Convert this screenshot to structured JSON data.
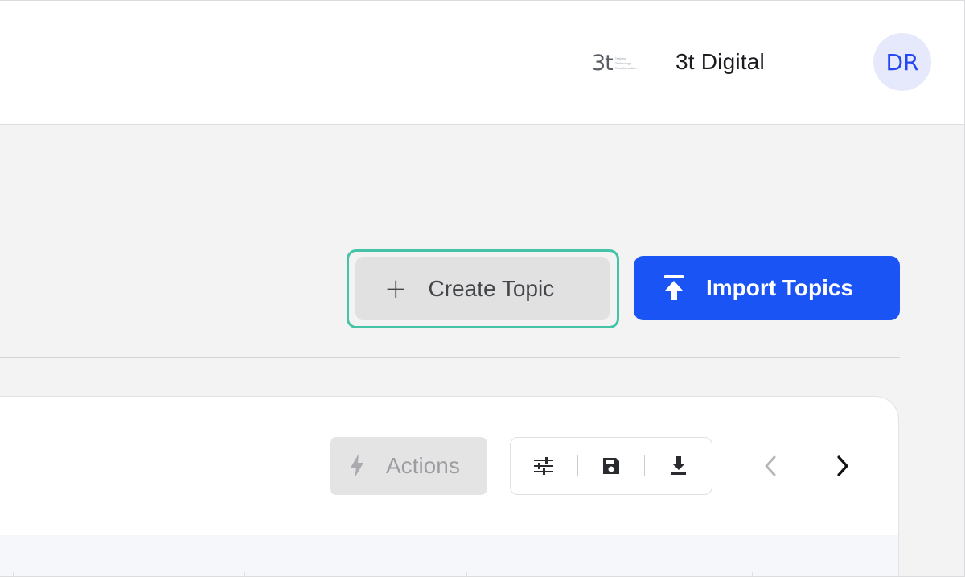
{
  "header": {
    "org_logo": {
      "mark": "3t",
      "tagline": [
        "Training",
        "Technology",
        "Transformation"
      ]
    },
    "org_name": "3t Digital",
    "avatar_initials": "DR"
  },
  "toolbar": {
    "create_label": "Create Topic",
    "create_icon": "plus-icon",
    "import_label": "Import Topics",
    "import_icon": "upload-icon"
  },
  "table_controls": {
    "actions_label": "Actions",
    "actions_icon": "lightning-icon",
    "actions_enabled": false,
    "tools": [
      "sliders-icon",
      "save-icon",
      "download-icon"
    ],
    "prev_enabled": false,
    "next_enabled": true
  },
  "colors": {
    "primary": "#1b54f5",
    "focus_ring": "#45c3a7",
    "avatar_bg": "#e6e8fb",
    "avatar_text": "#2447f3"
  }
}
